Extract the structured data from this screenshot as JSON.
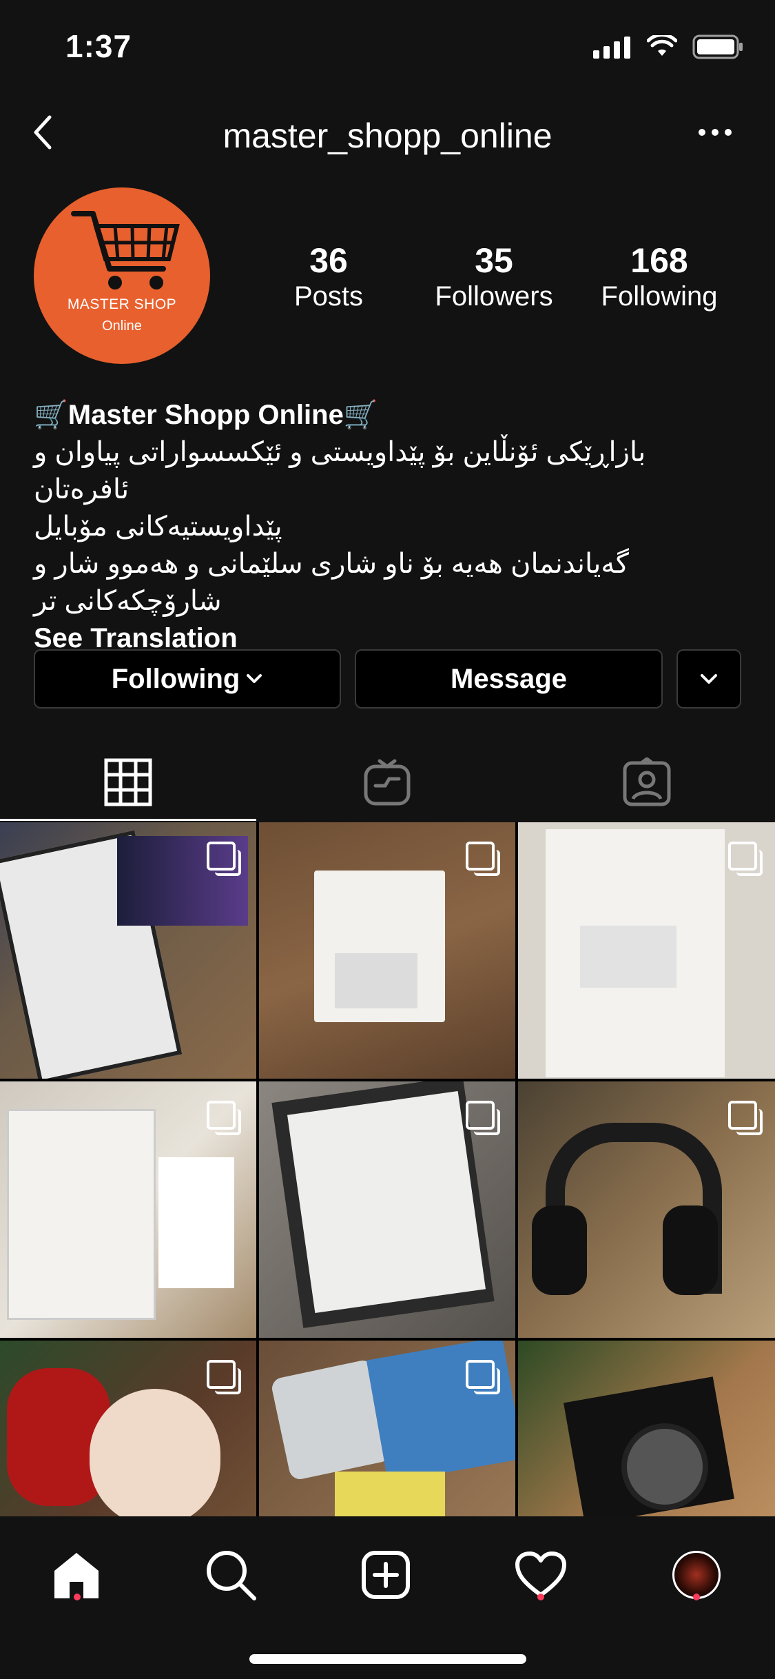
{
  "status_bar": {
    "time": "1:37"
  },
  "header": {
    "username": "master_shopp_online"
  },
  "avatar": {
    "line1": "MASTER SHOP",
    "line2": "Online"
  },
  "stats": [
    {
      "value": "36",
      "label": "Posts"
    },
    {
      "value": "35",
      "label": "Followers"
    },
    {
      "value": "168",
      "label": "Following"
    }
  ],
  "bio": {
    "name": "🛒Master Shopp Online🛒",
    "line1": "بازاڕێکی ئۆنڵاین بۆ پێداویستی و ئێکسسواراتی پیاوان و ئافرەتان",
    "line2": "پێداویستیەکانی مۆبایل",
    "line3": "گەیاندنمان هەیە بۆ ناو شاری سلێمانی و هەموو شار و",
    "line4": "شارۆچکەکانی تر",
    "see_translation": "See Translation"
  },
  "actions": {
    "following": "Following",
    "message": "Message"
  },
  "posts": [
    {
      "name": "charger-box",
      "bg": "#7a5a3c"
    },
    {
      "name": "usb-adapter",
      "bg": "#6e4f35"
    },
    {
      "name": "iphone-adapter",
      "bg": "#d9d4cc"
    },
    {
      "name": "huawei-charger",
      "bg": "#d8d2c8"
    },
    {
      "name": "earpods",
      "bg": "#8b8680"
    },
    {
      "name": "headphones",
      "bg": "#6d5a42"
    },
    {
      "name": "earmuffs",
      "bg": "#5a3b2a"
    },
    {
      "name": "adapter-cubes",
      "bg": "#6a4e38"
    },
    {
      "name": "watch-box",
      "bg": "#a4784c"
    }
  ],
  "colors": {
    "background": "#121212",
    "avatar": "#e8602d",
    "notification": "#ff3b5c"
  },
  "nav_icons": [
    "home-icon",
    "search-icon",
    "add-post-icon",
    "heart-icon",
    "profile-avatar-icon"
  ]
}
